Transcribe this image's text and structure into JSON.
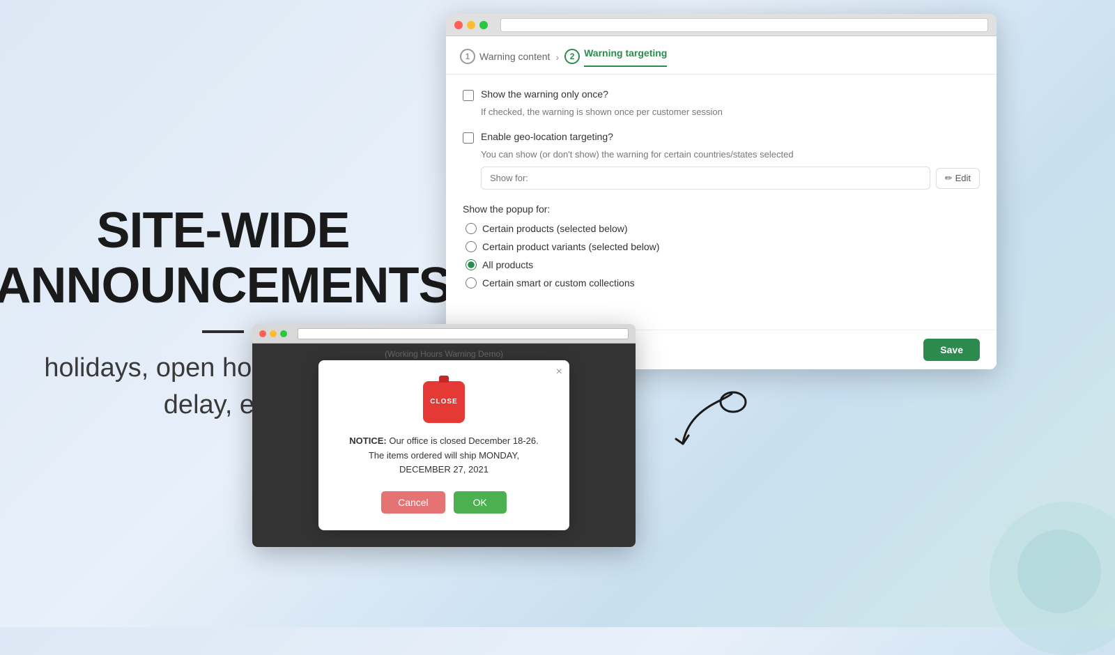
{
  "left": {
    "title_line1": "SITE-WIDE",
    "title_line2": "ANNOUNCEMENTS",
    "subtitle": "holidays, open hours, shipping delay, etc."
  },
  "browser": {
    "step1": {
      "number": "1",
      "label": "Warning content"
    },
    "step2": {
      "number": "2",
      "label": "Warning targeting"
    },
    "show_once": {
      "label": "Show the warning only once?",
      "hint": "If checked, the warning is shown once per customer session"
    },
    "geo_location": {
      "label": "Enable geo-location targeting?",
      "hint": "You can show (or don't show) the warning for certain countries/states selected",
      "input_placeholder": "Show for:",
      "edit_label": "Edit"
    },
    "popup_for_label": "Show the popup for:",
    "radio_options": [
      {
        "value": "certain_products",
        "label": "Certain products (selected below)"
      },
      {
        "value": "certain_variants",
        "label": "Certain product variants (selected below)"
      },
      {
        "value": "all_products",
        "label": "All products",
        "checked": true
      },
      {
        "value": "certain_collections",
        "label": "Certain smart or custom collections"
      }
    ],
    "save_label": "Save"
  },
  "popup_window": {
    "background_text": "(Working Hours Warning Demo)"
  },
  "modal": {
    "close_icon": "×",
    "sign_text": "CLOSE",
    "notice_bold": "NOTICE:",
    "notice_text": " Our office is closed December 18-26. The items ordered will ship MONDAY, DECEMBER 27, 2021",
    "cancel_label": "Cancel",
    "ok_label": "OK"
  }
}
